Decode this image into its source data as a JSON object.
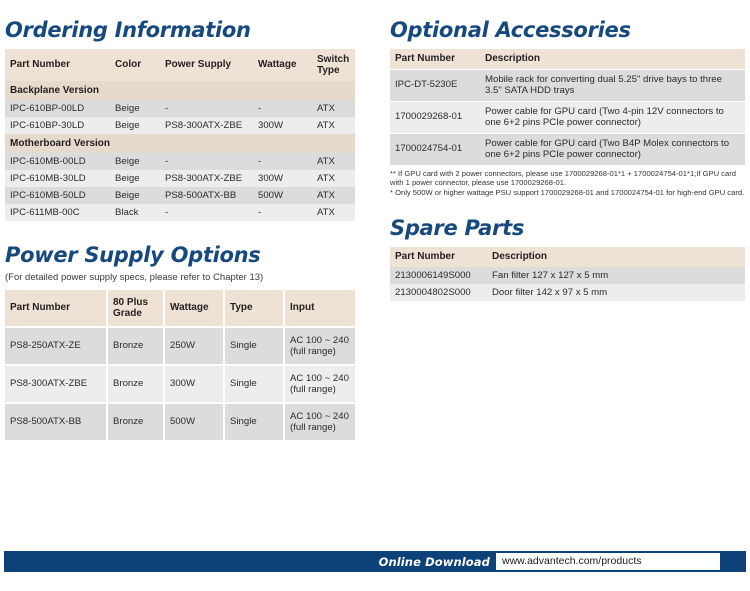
{
  "ordering": {
    "title": "Ordering Information",
    "columns": [
      "Part Number",
      "Color",
      "Power Supply",
      "Wattage",
      "Switch Type"
    ],
    "groups": [
      {
        "label": "Backplane Version",
        "rows": [
          [
            "IPC-610BP-00LD",
            "Beige",
            "-",
            "-",
            "ATX"
          ],
          [
            "IPC-610BP-30LD",
            "Beige",
            "PS8-300ATX-ZBE",
            "300W",
            "ATX"
          ]
        ]
      },
      {
        "label": "Motherboard Version",
        "rows": [
          [
            "IPC-610MB-00LD",
            "Beige",
            "-",
            "-",
            "ATX"
          ],
          [
            "IPC-610MB-30LD",
            "Beige",
            "PS8-300ATX-ZBE",
            "300W",
            "ATX"
          ],
          [
            "IPC-610MB-50LD",
            "Beige",
            "PS8-500ATX-BB",
            "500W",
            "ATX"
          ],
          [
            "IPC-611MB-00C",
            "Black",
            "-",
            "-",
            "ATX"
          ]
        ]
      }
    ]
  },
  "psu": {
    "title": "Power Supply Options",
    "note": "(For detailed power supply specs, please refer to Chapter 13)",
    "columns": [
      "Part Number",
      "80 Plus Grade",
      "Wattage",
      "Type",
      "Input"
    ],
    "rows": [
      [
        "PS8-250ATX-ZE",
        "Bronze",
        "250W",
        "Single",
        "AC 100 ~ 240 (full range)"
      ],
      [
        "PS8-300ATX-ZBE",
        "Bronze",
        "300W",
        "Single",
        "AC 100 ~ 240 (full range)"
      ],
      [
        "PS8-500ATX-BB",
        "Bronze",
        "500W",
        "Single",
        "AC 100 ~ 240 (full range)"
      ]
    ]
  },
  "accessories": {
    "title": "Optional Accessories",
    "columns": [
      "Part Number",
      "Description"
    ],
    "rows": [
      [
        "IPC-DT-5230E",
        "Mobile rack for converting dual 5.25\" drive bays to three 3.5\" SATA HDD trays"
      ],
      [
        "1700029268-01",
        "Power cable for GPU card (Two 4-pin 12V connectors to one 6+2 pins PCIe power connector)"
      ],
      [
        "1700024754-01",
        "Power cable for GPU card (Two B4P Molex connectors to one 6+2 pins PCIe power connector)"
      ]
    ],
    "footnotes": [
      "** If GPU card with 2 power connectors, please use 1700029268-01*1 + 1700024754-01*1;If GPU card with 1 power connector, please use 1700029268-01.",
      "* Only 500W or higher wattage PSU support 1700029268-01 and 1700024754-01 for high-end GPU card."
    ]
  },
  "spares": {
    "title": "Spare Parts",
    "columns": [
      "Part Number",
      "Description"
    ],
    "rows": [
      [
        "2130006149S000",
        "Fan filter 127 x 127 x 5 mm"
      ],
      [
        "2130004802S000",
        "Door filter 142 x 97 x 5 mm"
      ]
    ]
  },
  "footer": {
    "label": "Online Download",
    "url": "www.advantech.com/products"
  },
  "colors": {
    "heading_blue": "#17497f",
    "table_header_beige": "#eee2d5",
    "table_section_beige": "#e6dacc",
    "row_dark": "#dcdcdc",
    "row_light": "#ededed",
    "footer_blue": "#0d4279"
  }
}
